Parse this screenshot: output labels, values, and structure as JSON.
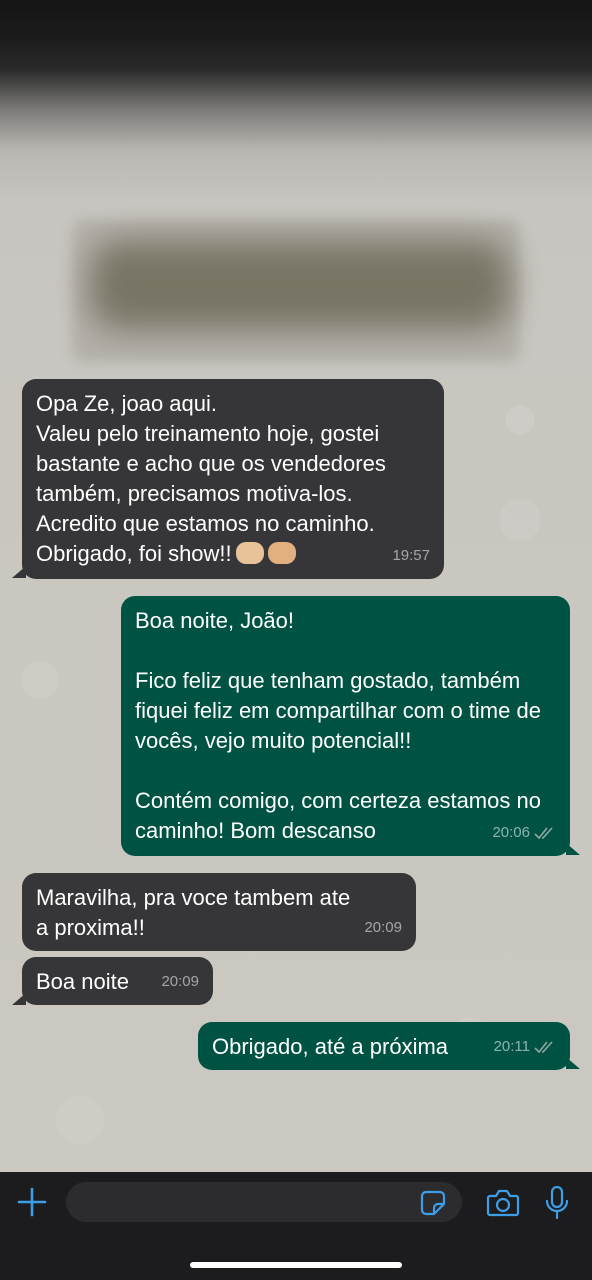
{
  "messages": [
    {
      "direction": "incoming",
      "text": "Opa Ze, joao aqui.\nValeu pelo treinamento hoje, gostei bastante e acho que os vendedores também, precisamos motiva-los.\nAcredito que estamos no caminho.\nObrigado, foi show!!",
      "emoji": [
        "oncoming-fist-emoji",
        "handshake-emoji"
      ],
      "time": "19:57"
    },
    {
      "direction": "outgoing",
      "text": "Boa noite, João!\n\nFico feliz que tenham gostado, também fiquei feliz em compartilhar com o time de vocês, vejo muito potencial!!\n\nContém comigo, com certeza estamos no caminho! Bom descanso",
      "time": "20:06",
      "status": "read"
    },
    {
      "direction": "incoming",
      "text": "Maravilha, pra voce tambem ate a proxima!!",
      "time": "20:09"
    },
    {
      "direction": "incoming",
      "text": "Boa noite",
      "time": "20:09"
    },
    {
      "direction": "outgoing",
      "text": "Obrigado, até a próxima",
      "time": "20:11",
      "status": "read"
    }
  ],
  "input_bar": {
    "icons": [
      "plus-icon",
      "sticker-icon",
      "camera-icon",
      "microphone-icon"
    ],
    "accent_color": "#3d9ee8"
  },
  "colors": {
    "incoming_bubble": "#363639",
    "outgoing_bubble": "#005343",
    "read_ticks": "#8fa7a0"
  }
}
